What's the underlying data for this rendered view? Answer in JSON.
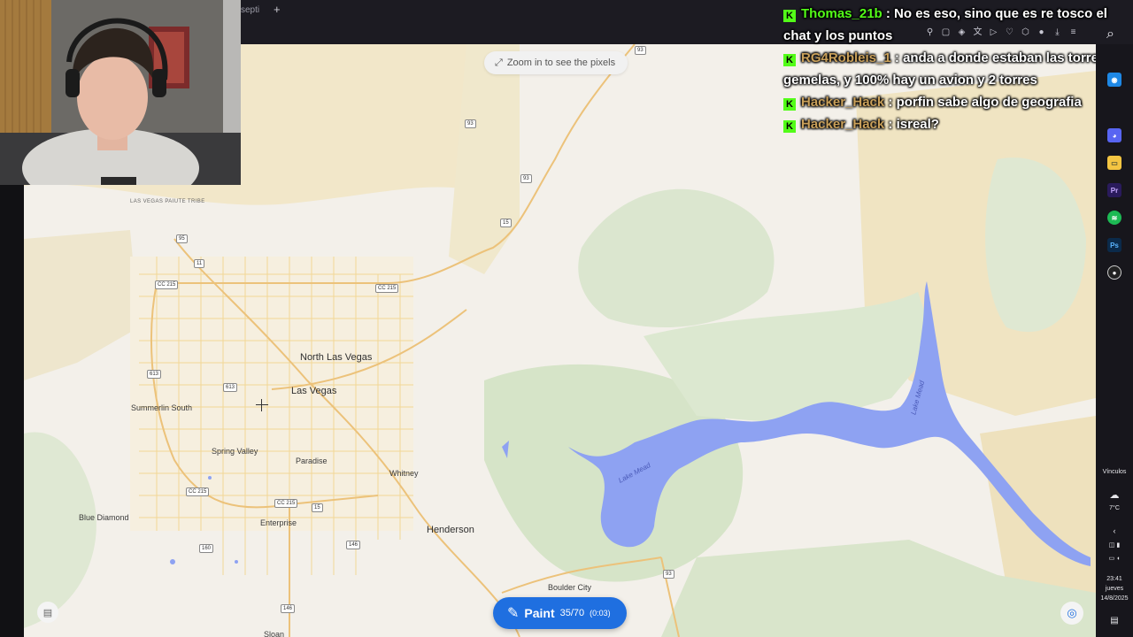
{
  "browser": {
    "tab_fragment": "septi",
    "new_tab_glyph": "+",
    "toolbar_icons": [
      "pin-icon",
      "bookmark-icon",
      "shield-icon",
      "translate-icon",
      "play-icon",
      "heart-icon",
      "extension-icon",
      "avatar-icon",
      "download-icon",
      "menu-icon"
    ]
  },
  "map": {
    "zoom_hint": "Zoom in to see the pixels",
    "places": {
      "north_las_vegas": "North Las Vegas",
      "las_vegas": "Las Vegas",
      "summerlin_south": "Summerlin South",
      "spring_valley": "Spring Valley",
      "paradise": "Paradise",
      "whitney": "Whitney",
      "enterprise": "Enterprise",
      "henderson": "Henderson",
      "blue_diamond": "Blue Diamond",
      "boulder_city": "Boulder City",
      "sloan": "Sloan",
      "reservation": "LAS VEGAS PAIUTE TRIBE",
      "lake_mead": "Lake Mead"
    },
    "shields": [
      "93",
      "93",
      "95",
      "11",
      "CC 215",
      "CC 215",
      "613",
      "613",
      "15",
      "CC 215",
      "CC 215",
      "15",
      "160",
      "146",
      "146",
      "93",
      "93"
    ],
    "paint": {
      "label": "Paint",
      "count": "35/70",
      "timer": "(0:03)"
    }
  },
  "chat": [
    {
      "user": "Thomas_21b",
      "text": "No es eso, sino que es re tosco el chat y los puntos",
      "color": "#53fc18"
    },
    {
      "user": "RG4Robleis_1",
      "text": "anda a donde estaban las torres gemelas, y 100% hay un avion y 2 torres",
      "color": "#c9a05a"
    },
    {
      "user": "Hacker_Hack",
      "text": "porfin sabe algo de geografia",
      "color": "#c9a05a"
    },
    {
      "user": "Hacker_Hack",
      "text": "isreal?",
      "color": "#c9a05a"
    }
  ],
  "taskbar": {
    "links_label": "Vínculos",
    "temperature": "7°C",
    "time": "23:41",
    "day": "jueves",
    "date": "14/8/2025",
    "apps": [
      "chrome-icon",
      "discord-icon",
      "file-explorer-icon",
      "premiere-icon",
      "spotify-icon",
      "photoshop-icon",
      "obs-icon"
    ]
  }
}
